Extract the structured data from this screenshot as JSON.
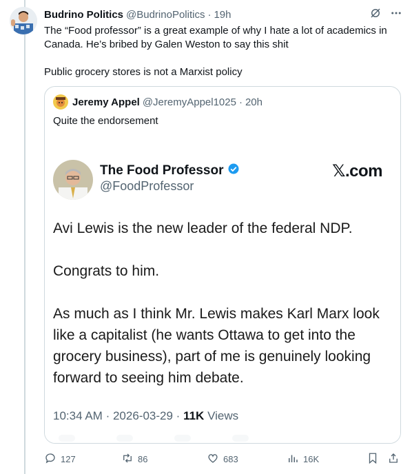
{
  "tweet": {
    "author_name": "Budrino Politics",
    "handle": "@BudrinoPolitics",
    "separator": "·",
    "time": "19h",
    "text_line1": "The “Food professor” is a great example of why I hate a lot of academics in Canada. He’s bribed by Galen Weston to say this shit",
    "text_line2": "Public grocery stores is not a Marxist policy"
  },
  "quote": {
    "author_name": "Jeremy Appel",
    "handle": "@JeremyAppel1025",
    "separator": "·",
    "time": "20h",
    "text": "Quite the endorsement",
    "screenshot": {
      "name": "The Food Professor",
      "handle": "@FoodProfessor",
      "brand": "𝕏.com",
      "body_p1": "Avi Lewis is the new leader of the federal NDP.",
      "body_p2": "Congrats to him.",
      "body_p3": "As much as I think Mr. Lewis makes Karl Marx look like a capitalist (he wants Ottawa to get into the grocery business), part of me is genuinely looking forward to seeing him debate.",
      "time": "10:34 AM",
      "sep1": "·",
      "date": "2026-03-29",
      "sep2": "·",
      "views_count": "11K",
      "views_label": "Views"
    }
  },
  "actions": {
    "replies": "127",
    "reposts": "86",
    "likes": "683",
    "views": "16K"
  },
  "colors": {
    "verified": "#1d9bf0",
    "secondary_text": "#536471",
    "border": "#cfd9de"
  }
}
